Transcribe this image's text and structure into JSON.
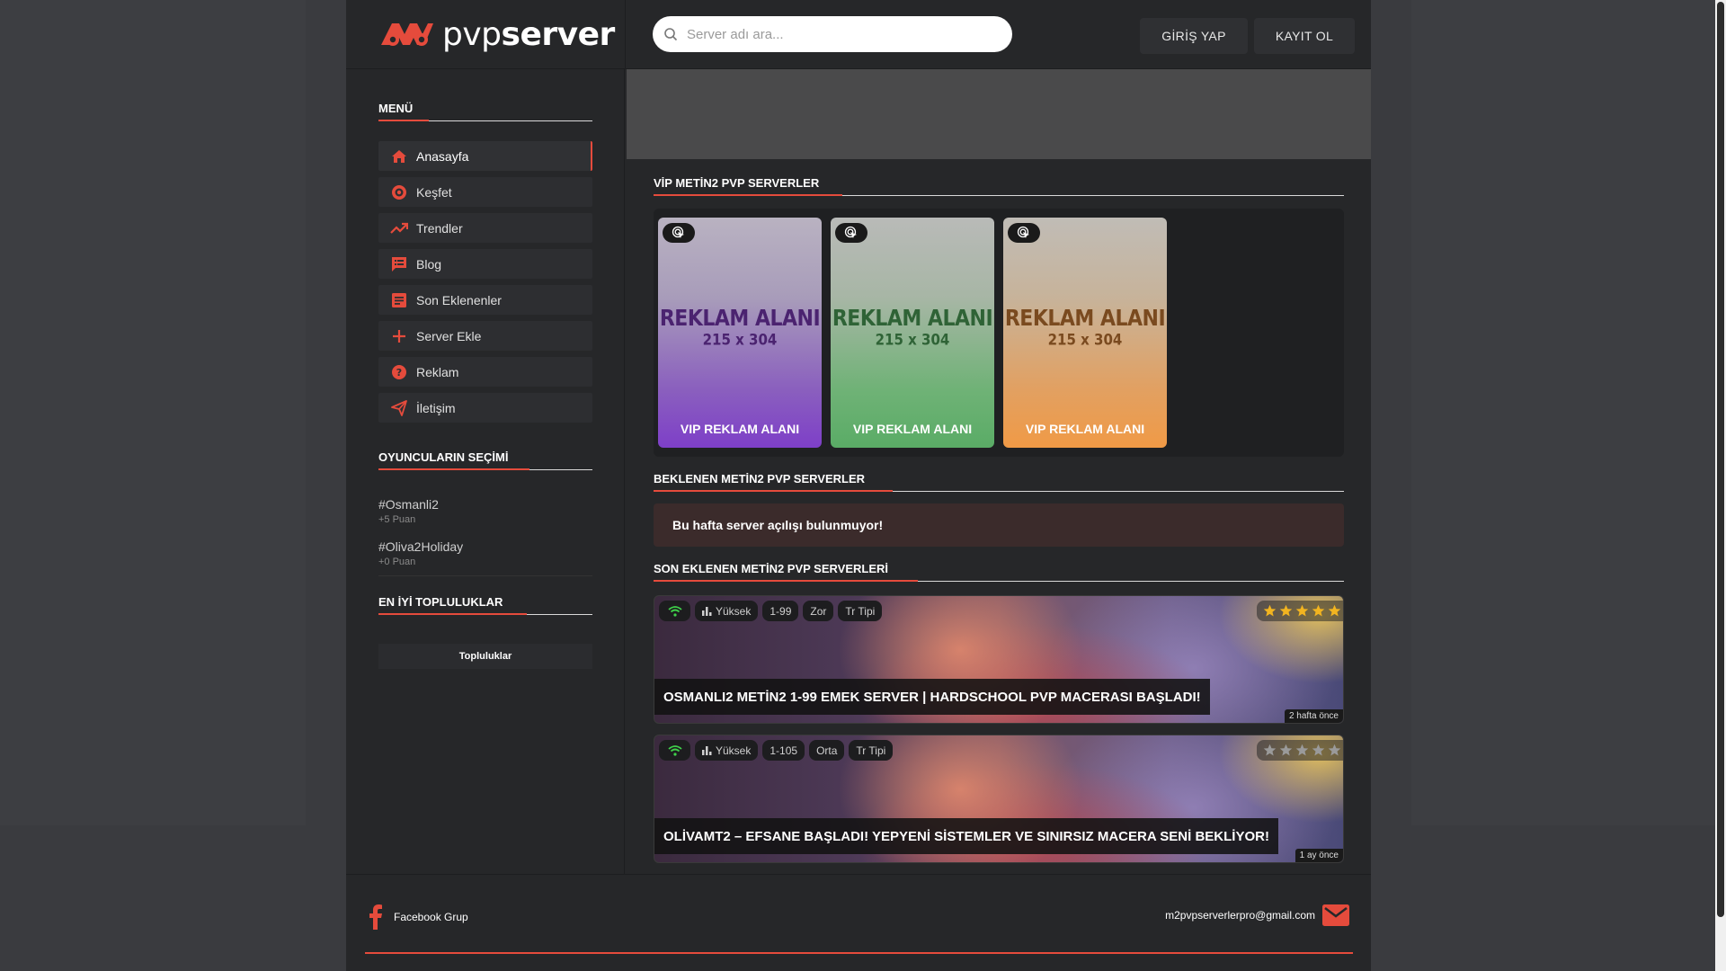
{
  "brand": {
    "logo_text_light": "pvp",
    "logo_text_bold": "server",
    "accent": "#e54b3c"
  },
  "header": {
    "search_placeholder": "Server adı ara...",
    "login": "GİRİŞ YAP",
    "register": "KAYIT OL"
  },
  "sidebar": {
    "menu_title": "MENÜ",
    "items": [
      {
        "label": "Anasayfa",
        "icon": "home-icon"
      },
      {
        "label": "Keşfet",
        "icon": "target-icon"
      },
      {
        "label": "Trendler",
        "icon": "trending-up-icon"
      },
      {
        "label": "Blog",
        "icon": "article-icon"
      },
      {
        "label": "Son Eklenenler",
        "icon": "document-icon"
      },
      {
        "label": "Server Ekle",
        "icon": "plus-icon"
      },
      {
        "label": "Reklam",
        "icon": "help-circle-icon"
      },
      {
        "label": "İletişim",
        "icon": "send-icon"
      }
    ],
    "choice_title": "OYUNCULARIN SEÇİMİ",
    "choices": [
      {
        "name": "#Osmanli2",
        "points": "+5 Puan"
      },
      {
        "name": "#Oliva2Holiday",
        "points": "+0 Puan"
      }
    ],
    "community_title": "EN İYİ TOPLULUKLAR",
    "community_button": "Topluluklar"
  },
  "main": {
    "vip_title": "VİP METİN2 PVP SERVERLER",
    "vip_cards": [
      {
        "big": "REKLAM ALANI",
        "size": "215 x 304",
        "label": "VIP REKLAM ALANI"
      },
      {
        "big": "REKLAM ALANI",
        "size": "215 x 304",
        "label": "VIP REKLAM ALANI"
      },
      {
        "big": "REKLAM ALANI",
        "size": "215 x 304",
        "label": "VIP REKLAM ALANI"
      }
    ],
    "expected_title": "BEKLENEN METİN2 PVP SERVERLER",
    "expected_notice": "Bu hafta server açılışı bulunmuyor!",
    "latest_title": "SON EKLENEN METİN2 PVP SERVERLERİ",
    "servers": [
      {
        "rate": "Yüksek",
        "level": "1-99",
        "difficulty": "Zor",
        "type": "Tr Tipi",
        "stars": 5,
        "title": "OSMANLI2 METİN2 1-99 EMEK SERVER | HARDSCHOOL PVP MACERASI BAŞLADI!",
        "time": "2 hafta önce"
      },
      {
        "rate": "Yüksek",
        "level": "1-105",
        "difficulty": "Orta",
        "type": "Tr Tipi",
        "stars": 0,
        "title": "OLİVAMT2 – EFSANE BAŞLADI! YEPYENİ SİSTEMLER VE SINIRSIZ MACERA SENİ BEKLİYOR!",
        "time": "1 ay önce"
      }
    ]
  },
  "footer": {
    "facebook": "Facebook Grup",
    "email": "m2pvpserverlerpro@gmail.com"
  }
}
